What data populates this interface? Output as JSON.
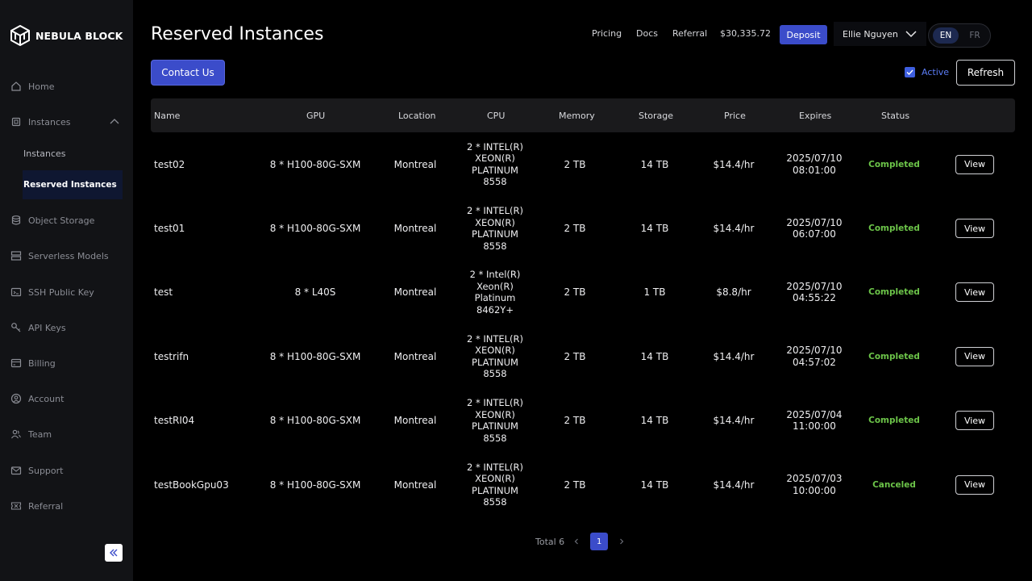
{
  "brand": {
    "name": "NEBULA BLOCK"
  },
  "sidebar": {
    "items": [
      {
        "label": "Home",
        "icon": "home-icon"
      },
      {
        "label": "Instances",
        "icon": "chip-icon"
      },
      {
        "label": "Object Storage",
        "icon": "database-icon"
      },
      {
        "label": "Serverless Models",
        "icon": "server-icon"
      },
      {
        "label": "SSH Public Key",
        "icon": "ssh-key-icon"
      },
      {
        "label": "API Keys",
        "icon": "key-icon"
      },
      {
        "label": "Billing",
        "icon": "billing-icon"
      },
      {
        "label": "Account",
        "icon": "account-icon"
      },
      {
        "label": "Team",
        "icon": "team-icon"
      },
      {
        "label": "Support",
        "icon": "mail-icon"
      },
      {
        "label": "Referral",
        "icon": "ticket-icon"
      }
    ],
    "sub_items": [
      {
        "label": "Instances"
      },
      {
        "label": "Reserved Instances",
        "active": true
      }
    ]
  },
  "header": {
    "title": "Reserved Instances",
    "links": {
      "pricing": "Pricing",
      "docs": "Docs",
      "referral": "Referral"
    },
    "balance": "$30,335.72",
    "deposit": "Deposit",
    "user": "Ellie Nguyen",
    "lang": {
      "en": "EN",
      "fr": "FR",
      "selected": "EN"
    }
  },
  "toolbar": {
    "contact": "Contact Us",
    "active_label": "Active",
    "active_checked": true,
    "refresh": "Refresh"
  },
  "table": {
    "columns": [
      "Name",
      "GPU",
      "Location",
      "CPU",
      "Memory",
      "Storage",
      "Price",
      "Expires",
      "Status"
    ],
    "rows": [
      {
        "name": "test02",
        "gpu": "8 * H100-80G-SXM",
        "location": "Montreal",
        "cpu": [
          "2 * INTEL(R)",
          "XEON(R)",
          "PLATINUM",
          "8558"
        ],
        "memory": "2 TB",
        "storage": "14 TB",
        "price": "$14.4/hr",
        "expires": [
          "2025/07/10",
          "08:01:00"
        ],
        "status": "Completed",
        "action": "View"
      },
      {
        "name": "test01",
        "gpu": "8 * H100-80G-SXM",
        "location": "Montreal",
        "cpu": [
          "2 * INTEL(R)",
          "XEON(R)",
          "PLATINUM",
          "8558"
        ],
        "memory": "2 TB",
        "storage": "14 TB",
        "price": "$14.4/hr",
        "expires": [
          "2025/07/10",
          "06:07:00"
        ],
        "status": "Completed",
        "action": "View"
      },
      {
        "name": "test",
        "gpu": "8 * L40S",
        "location": "Montreal",
        "cpu": [
          "2 * Intel(R)",
          "Xeon(R)",
          "Platinum",
          "8462Y+"
        ],
        "memory": "2 TB",
        "storage": "1 TB",
        "price": "$8.8/hr",
        "expires": [
          "2025/07/10",
          "04:55:22"
        ],
        "status": "Completed",
        "action": "View"
      },
      {
        "name": "testrifn",
        "gpu": "8 * H100-80G-SXM",
        "location": "Montreal",
        "cpu": [
          "2 * INTEL(R)",
          "XEON(R)",
          "PLATINUM",
          "8558"
        ],
        "memory": "2 TB",
        "storage": "14 TB",
        "price": "$14.4/hr",
        "expires": [
          "2025/07/10",
          "04:57:02"
        ],
        "status": "Completed",
        "action": "View"
      },
      {
        "name": "testRI04",
        "gpu": "8 * H100-80G-SXM",
        "location": "Montreal",
        "cpu": [
          "2 * INTEL(R)",
          "XEON(R)",
          "PLATINUM",
          "8558"
        ],
        "memory": "2 TB",
        "storage": "14 TB",
        "price": "$14.4/hr",
        "expires": [
          "2025/07/04",
          "11:00:00"
        ],
        "status": "Completed",
        "action": "View"
      },
      {
        "name": "testBookGpu03",
        "gpu": "8 * H100-80G-SXM",
        "location": "Montreal",
        "cpu": [
          "2 * INTEL(R)",
          "XEON(R)",
          "PLATINUM",
          "8558"
        ],
        "memory": "2 TB",
        "storage": "14 TB",
        "price": "$14.4/hr",
        "expires": [
          "2025/07/03",
          "10:00:00"
        ],
        "status": "Canceled",
        "action": "View"
      }
    ]
  },
  "pagination": {
    "total": "Total 6",
    "current": "1"
  },
  "colors": {
    "accent": "#3b4cca",
    "status_green": "#6cc449",
    "sidebar_bg": "#121316",
    "background": "#000000"
  }
}
